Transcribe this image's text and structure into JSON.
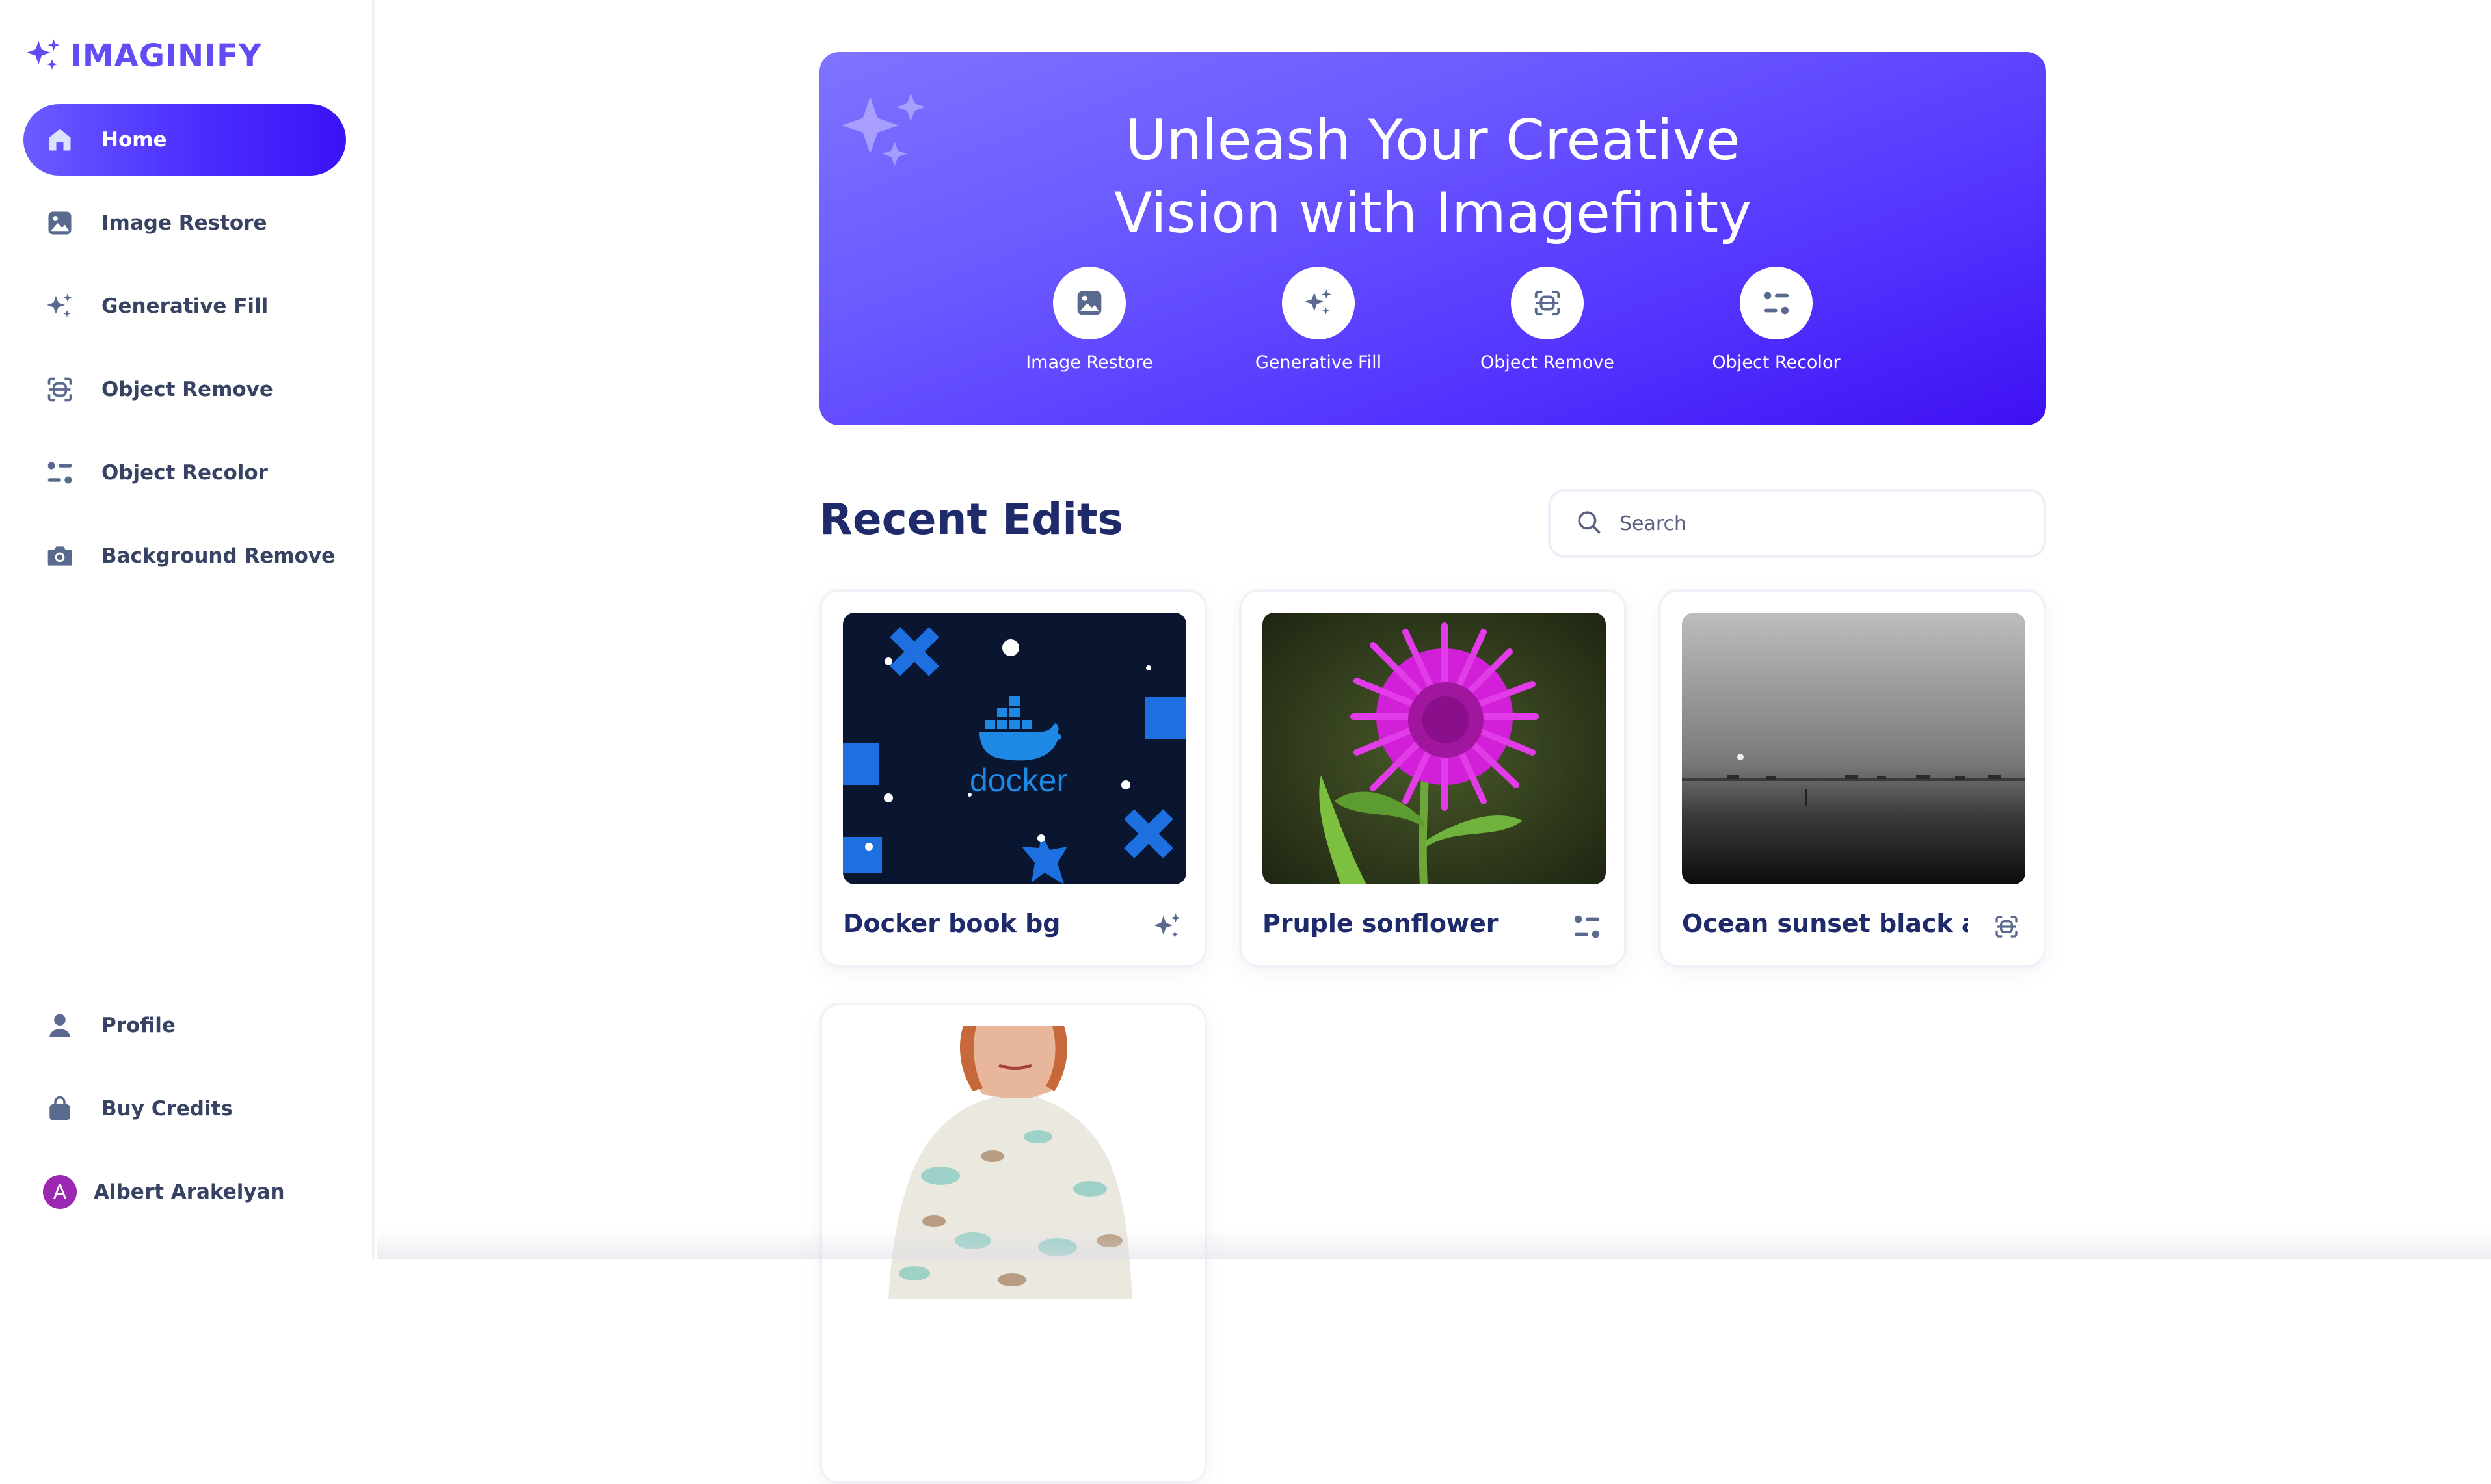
{
  "brand": {
    "name": "IMAGINIFY",
    "color": "#624cf5"
  },
  "sidebar": {
    "items": [
      {
        "label": "Home",
        "icon": "home-icon",
        "active": true
      },
      {
        "label": "Image Restore",
        "icon": "image-icon"
      },
      {
        "label": "Generative Fill",
        "icon": "sparkles-icon"
      },
      {
        "label": "Object Remove",
        "icon": "scan-icon"
      },
      {
        "label": "Object Recolor",
        "icon": "filter-icon"
      },
      {
        "label": "Background Remove",
        "icon": "camera-icon"
      }
    ],
    "bottom": [
      {
        "label": "Profile",
        "icon": "user-icon"
      },
      {
        "label": "Buy Credits",
        "icon": "bag-icon"
      }
    ],
    "user": {
      "initial": "A",
      "name": "Albert Arakelyan"
    }
  },
  "hero": {
    "title_line1": "Unleash Your Creative",
    "title_line2": "Vision with Imagefinity",
    "tools": [
      {
        "label": "Image Restore",
        "icon": "image-icon"
      },
      {
        "label": "Generative Fill",
        "icon": "sparkles-icon"
      },
      {
        "label": "Object Remove",
        "icon": "scan-icon"
      },
      {
        "label": "Object Recolor",
        "icon": "filter-icon"
      }
    ]
  },
  "recent": {
    "title": "Recent Edits",
    "search_placeholder": "Search",
    "cards": [
      {
        "title": "Docker book bg",
        "icon": "sparkles-icon"
      },
      {
        "title": "Pruple sonflower",
        "icon": "filter-icon"
      },
      {
        "title": "Ocean sunset black an...",
        "icon": "scan-icon"
      },
      {
        "title": "",
        "icon": ""
      }
    ]
  },
  "colors": {
    "accent": "#4a2dff",
    "text_dark": "#1f2a6b",
    "text_nav": "#384262"
  }
}
